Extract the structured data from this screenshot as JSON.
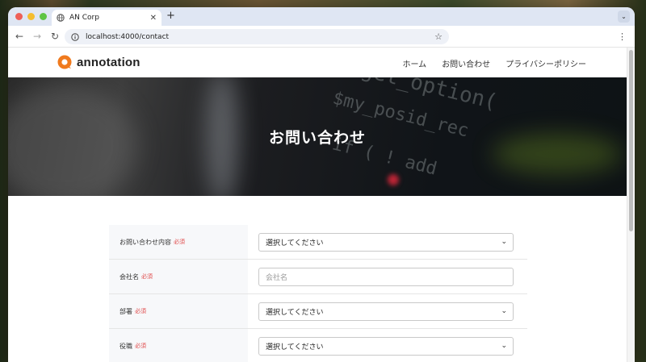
{
  "browser": {
    "tab_title": "AN Corp",
    "tab_close": "✕",
    "new_tab": "+",
    "tab_menu": "⌄",
    "url": "localhost:4000/contact",
    "back": "←",
    "forward": "→",
    "reload": "↻",
    "star": "☆",
    "menu": "⋮"
  },
  "site": {
    "logo_text": "annotation",
    "brand_color": "#f07a1e",
    "nav": [
      {
        "label": "ホーム"
      },
      {
        "label": "お問い合わせ"
      },
      {
        "label": "プライバシーポリシー"
      }
    ]
  },
  "hero": {
    "title": "お問い合わせ"
  },
  "form": {
    "required_label": "必須",
    "rows": [
      {
        "label": "お問い合わせ内容",
        "type": "select",
        "value": "選択してください"
      },
      {
        "label": "会社名",
        "type": "input",
        "placeholder": "会社名"
      },
      {
        "label": "部署",
        "type": "select",
        "value": "選択してください"
      },
      {
        "label": "役職",
        "type": "select",
        "value": "選択してください"
      }
    ]
  }
}
